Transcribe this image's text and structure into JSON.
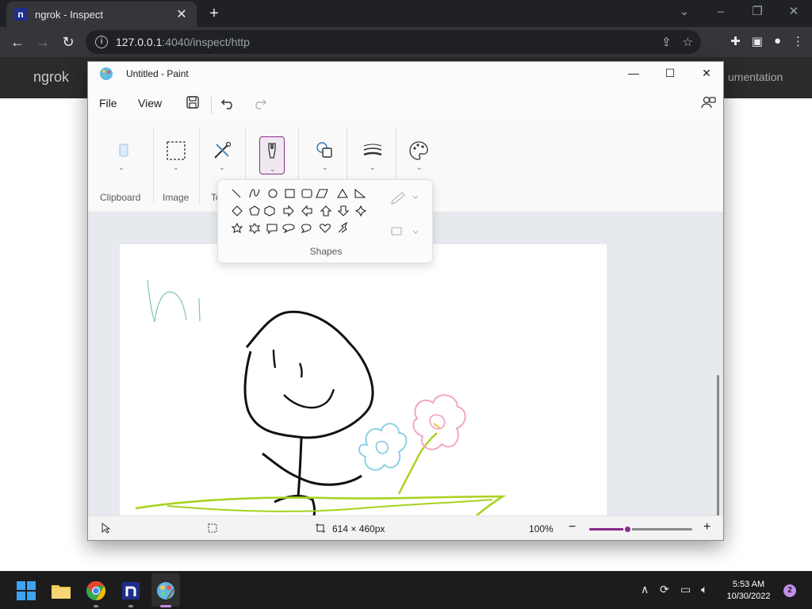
{
  "browser": {
    "tab_title": "ngrok - Inspect",
    "tab_favicon_letter": "n",
    "url_host": "127.0.0.1",
    "url_rest": ":4040/inspect/http"
  },
  "page": {
    "brand": "ngrok",
    "nav_partial": "umentation"
  },
  "paint": {
    "title": "Untitled - Paint",
    "menu": {
      "file": "File",
      "view": "View"
    },
    "ribbon_groups": {
      "clipboard": "Clipboard",
      "image": "Image",
      "tools_partial": "To"
    },
    "shapes_label": "Shapes",
    "status": {
      "canvas_size": "614 × 460px",
      "zoom": "100%",
      "zoom_level": 0.38
    },
    "colors": {
      "accent": "#8a2b8a",
      "grass": "#a8d21e",
      "flower_blue": "#8fd0e4",
      "flower_pink": "#f4a6c4",
      "handwriting": "#7fc4b8"
    }
  },
  "taskbar": {
    "time": "5:53 AM",
    "date": "10/30/2022",
    "notifications": "2"
  }
}
